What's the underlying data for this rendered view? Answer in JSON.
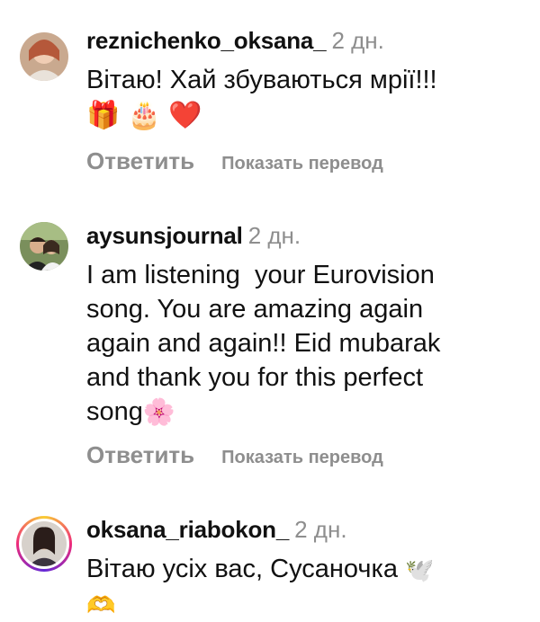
{
  "comments": [
    {
      "username": "reznichenko_oksana_",
      "time": "2 дн.",
      "text": "Вітаю! Хай збуваються мрії!!!",
      "emoji": [
        "🎁",
        "🎂",
        "❤️"
      ],
      "reply_label": "Ответить",
      "translate_label": "Показать перевод"
    },
    {
      "username": "aysunsjournal",
      "time": "2 дн.",
      "text_lines": [
        "I am listening  your Eurovision",
        "song. You are amazing again",
        "again and again!! Eid mubarak",
        "and thank you for this perfect",
        "song"
      ],
      "emoji": [
        "🌸"
      ],
      "reply_label": "Ответить",
      "translate_label": "Показать перевод"
    },
    {
      "username": "oksana_riabokon_",
      "time": "2 дн.",
      "text": "Вітаю усіх вас, Сусаночка",
      "emoji": [
        "🕊️",
        "🫶"
      ]
    }
  ]
}
